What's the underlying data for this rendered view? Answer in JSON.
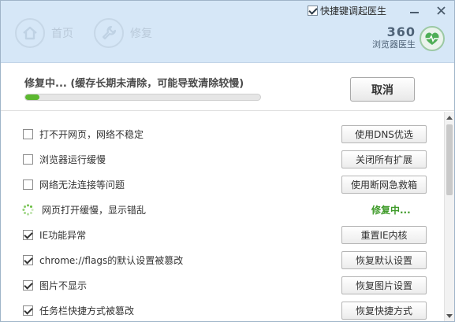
{
  "header": {
    "hotkey_label": "快捷键调起医生",
    "hotkey_checked": true,
    "nav": [
      {
        "label": "首页",
        "icon": "home-icon"
      },
      {
        "label": "修复",
        "icon": "wrench-icon"
      }
    ],
    "brand_number": "360",
    "brand_name": "浏览器医生"
  },
  "progress": {
    "title": "修复中... (缓存长期未清除，可能导致清除较慢)",
    "percent": 6,
    "cancel_label": "取消"
  },
  "items": [
    {
      "label": "打不开网页，网络不稳定",
      "checked": false,
      "action": "使用DNS优选"
    },
    {
      "label": "浏览器运行缓慢",
      "checked": false,
      "action": "关闭所有扩展"
    },
    {
      "label": "网络无法连接等问题",
      "checked": false,
      "action": "使用断网急救箱"
    },
    {
      "label": "网页打开缓慢，显示错乱",
      "in_progress": true,
      "status": "修复中..."
    },
    {
      "label": "IE功能异常",
      "checked": true,
      "action": "重置IE内核"
    },
    {
      "label": "chrome://flags的默认设置被篡改",
      "checked": true,
      "action": "恢复默认设置"
    },
    {
      "label": "图片不显示",
      "checked": true,
      "action": "恢复图片设置"
    },
    {
      "label": "任务栏快捷方式被篡改",
      "checked": true,
      "action": "恢复快捷方式"
    }
  ],
  "colors": {
    "accent": "#5cb830",
    "header_bg": "#d6e7f7",
    "status_green": "#3f9b2a"
  }
}
